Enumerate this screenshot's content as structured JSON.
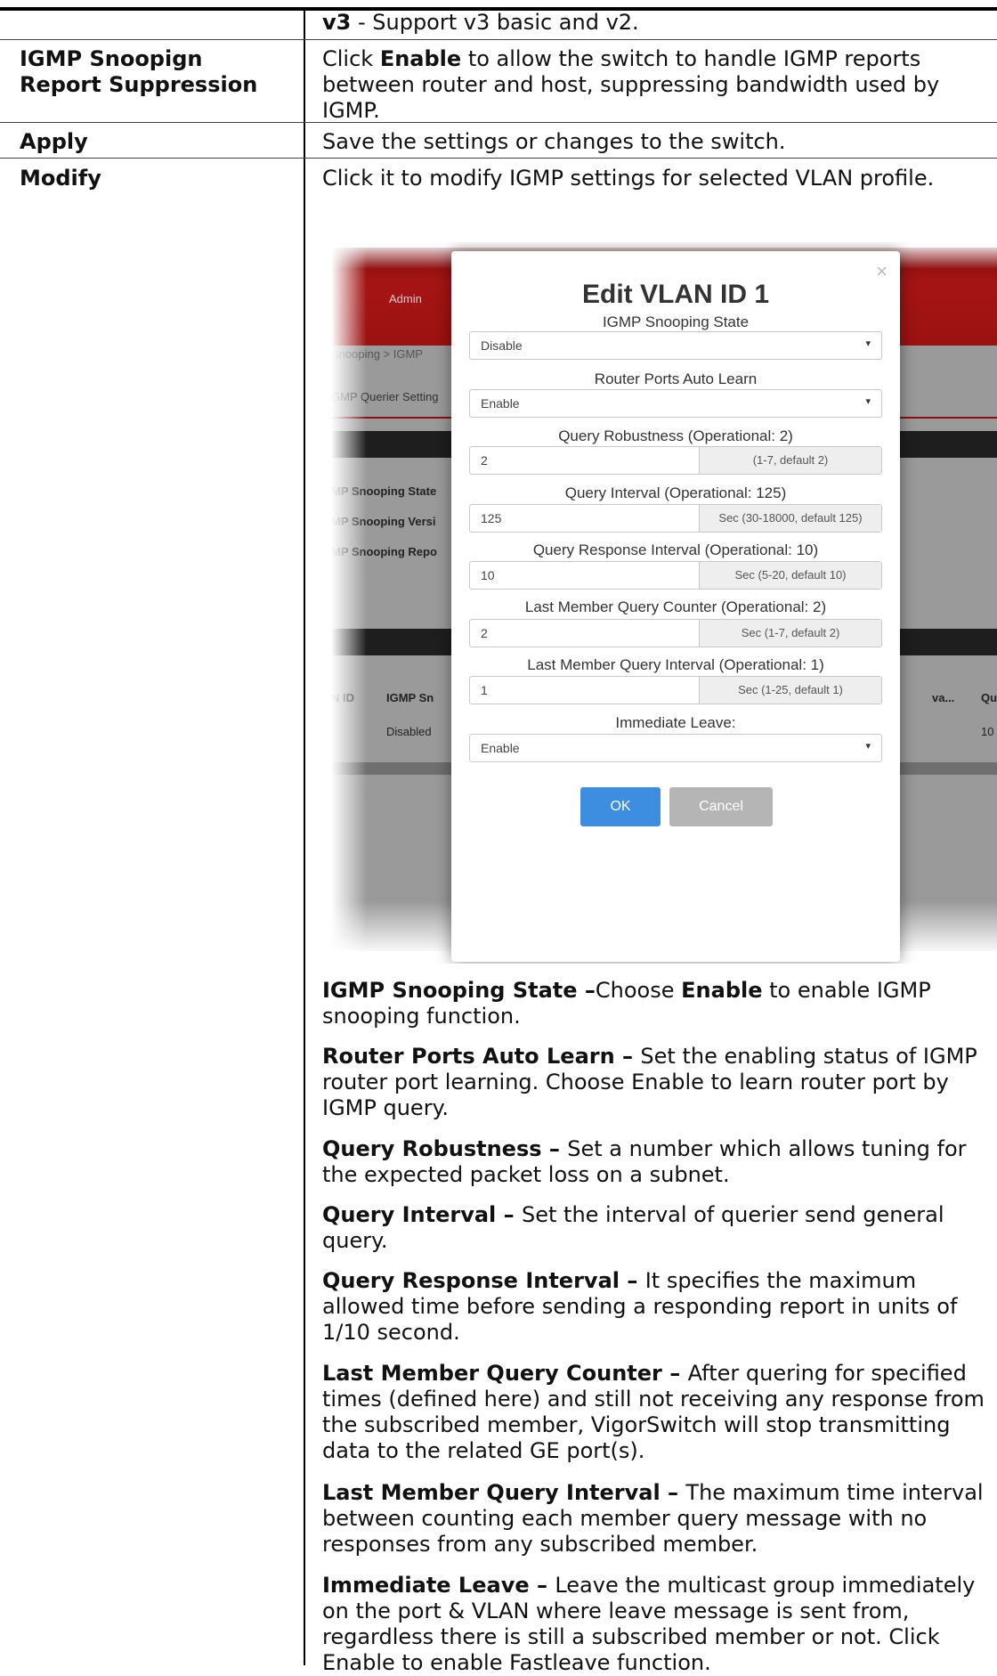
{
  "rows": [
    {
      "label": "",
      "text_bold": "v3",
      "text": " - Support v3 basic and v2."
    },
    {
      "label": "IGMP Snoopign Report Suppression",
      "pre": "Click ",
      "bold": "Enable",
      "post": " to allow the switch to handle IGMP reports between router and host, suppressing bandwidth used by IGMP."
    },
    {
      "label": "Apply",
      "text": "Save the settings or changes to the switch."
    },
    {
      "label": "Modify",
      "text": "Click it to modify IGMP settings for selected VLAN profile."
    }
  ],
  "screenshot": {
    "background": {
      "nav_admin": "Admin",
      "breadcrumb": "Snooping  > IGMP",
      "tab": "GMP Querier Setting",
      "labels": [
        "MP Snooping State",
        "MP Snooping Versi",
        "MP Snooping Repo"
      ],
      "col_vlan_id": "N ID",
      "col_igmp": "IGMP Sn",
      "col_va": "va...",
      "col_q": "Qu",
      "cell_disabled": "Disabled",
      "cell_10": "10"
    },
    "modal": {
      "title": "Edit VLAN ID 1",
      "close": "×",
      "fields": [
        {
          "label": "IGMP Snooping State",
          "value": "Disable",
          "type": "select"
        },
        {
          "label": "Router Ports Auto Learn",
          "value": "Enable",
          "type": "select"
        },
        {
          "label": "Query Robustness (Operational: 2)",
          "value": "2",
          "type": "input",
          "addon": "(1-7, default 2)"
        },
        {
          "label": "Query Interval (Operational: 125)",
          "value": "125",
          "type": "input",
          "addon": "Sec (30-18000, default 125)"
        },
        {
          "label": "Query Response Interval (Operational: 10)",
          "value": "10",
          "type": "input",
          "addon": "Sec (5-20, default 10)"
        },
        {
          "label": "Last Member Query Counter (Operational: 2)",
          "value": "2",
          "type": "input",
          "addon": "Sec (1-7, default 2)"
        },
        {
          "label": "Last Member Query Interval (Operational: 1)",
          "value": "1",
          "type": "input",
          "addon": "Sec (1-25, default 1)"
        },
        {
          "label": "Immediate Leave:",
          "value": "Enable",
          "type": "select"
        }
      ],
      "ok": "OK",
      "cancel": "Cancel"
    }
  },
  "descriptions": [
    {
      "term": "IGMP Snooping State",
      "sep": " –",
      "pre": "Choose ",
      "bold": "Enable",
      "post": " to enable IGMP snooping function."
    },
    {
      "term": "Router Ports Auto Learn",
      "sep": " – ",
      "text": "Set the enabling status of IGMP router port learning. Choose Enable to learn router port by IGMP query."
    },
    {
      "term": "Query Robustness",
      "sep": " – ",
      "text": "Set a number which allows tuning for the expected packet loss on a subnet."
    },
    {
      "term": "Query Interval",
      "sep": " – ",
      "text": "Set the interval of querier send general query."
    },
    {
      "term": "Query Response Interval",
      "sep": " – ",
      "text": "It specifies the maximum allowed time before sending a responding report in units of 1/10 second."
    },
    {
      "term": "Last Member Query Counter",
      "sep": " – ",
      "text": "After quering for specified times (defined here) and still not receiving any response from the subscribed member, VigorSwitch will stop transmitting data to the related GE port(s)."
    },
    {
      "term": "Last Member Query Interval",
      "sep": " – ",
      "text": "The maximum time interval between counting each member query message with no responses from any subscribed member."
    },
    {
      "term": "Immediate Leave",
      "sep": " – ",
      "text": "Leave the multicast group immediately on the port & VLAN where leave message is sent from, regardless there is still a subscribed member or not. Click Enable to enable Fastleave function."
    }
  ]
}
